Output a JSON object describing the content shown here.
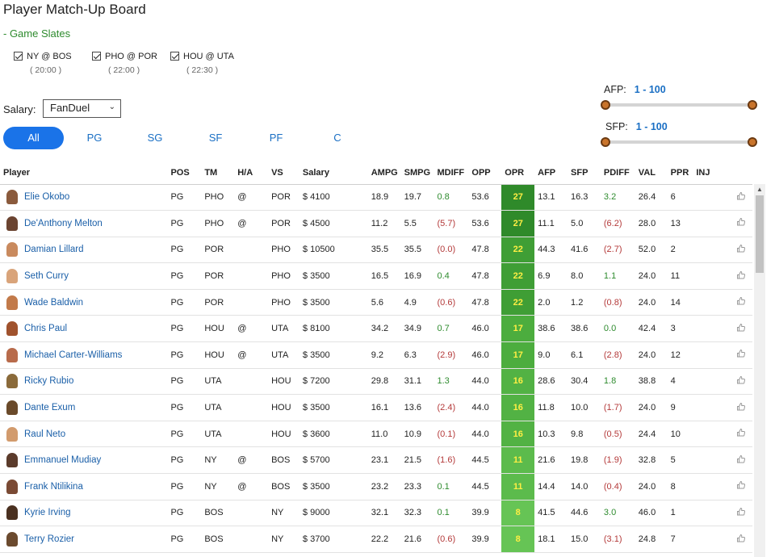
{
  "page": {
    "title": "Player Match-Up Board",
    "slates_toggle": "- Game Slates"
  },
  "slates": [
    {
      "label": "NY @ BOS",
      "time": "( 20:00 )",
      "checked": true
    },
    {
      "label": "PHO @ POR",
      "time": "( 22:00 )",
      "checked": true
    },
    {
      "label": "HOU @ UTA",
      "time": "( 22:30 )",
      "checked": true
    }
  ],
  "salary": {
    "label": "Salary:",
    "selected": "FanDuel"
  },
  "sliders": {
    "afp": {
      "label": "AFP:",
      "range": "1 - 100",
      "min": 1,
      "max": 100
    },
    "sfp": {
      "label": "SFP:",
      "range": "1 - 100",
      "min": 1,
      "max": 100
    }
  },
  "position_tabs": [
    {
      "label": "All",
      "active": true
    },
    {
      "label": "PG",
      "active": false
    },
    {
      "label": "SG",
      "active": false
    },
    {
      "label": "SF",
      "active": false
    },
    {
      "label": "PF",
      "active": false
    },
    {
      "label": "C",
      "active": false
    }
  ],
  "table": {
    "columns": [
      "Player",
      "POS",
      "TM",
      "H/A",
      "VS",
      "Salary",
      "AMPG",
      "SMPG",
      "MDIFF",
      "OPP",
      "OPR",
      "AFP",
      "SFP",
      "PDIFF",
      "VAL",
      "PPR",
      "INJ"
    ],
    "rows": [
      {
        "player": "Elie Okobo",
        "pos": "PG",
        "tm": "PHO",
        "ha": "@",
        "vs": "POR",
        "salary": "$ 4100",
        "ampg": "18.9",
        "smpg": "19.7",
        "mdiff": "0.8",
        "opp": "53.6",
        "opr": "27",
        "afp": "13.1",
        "sfp": "16.3",
        "pdiff": "3.2",
        "val": "26.4",
        "ppr": "6",
        "inj": ""
      },
      {
        "player": "De'Anthony Melton",
        "pos": "PG",
        "tm": "PHO",
        "ha": "@",
        "vs": "POR",
        "salary": "$ 4500",
        "ampg": "11.2",
        "smpg": "5.5",
        "mdiff": "(5.7)",
        "opp": "53.6",
        "opr": "27",
        "afp": "11.1",
        "sfp": "5.0",
        "pdiff": "(6.2)",
        "val": "28.0",
        "ppr": "13",
        "inj": ""
      },
      {
        "player": "Damian Lillard",
        "pos": "PG",
        "tm": "POR",
        "ha": "",
        "vs": "PHO",
        "salary": "$ 10500",
        "ampg": "35.5",
        "smpg": "35.5",
        "mdiff": "(0.0)",
        "opp": "47.8",
        "opr": "22",
        "afp": "44.3",
        "sfp": "41.6",
        "pdiff": "(2.7)",
        "val": "52.0",
        "ppr": "2",
        "inj": ""
      },
      {
        "player": "Seth Curry",
        "pos": "PG",
        "tm": "POR",
        "ha": "",
        "vs": "PHO",
        "salary": "$ 3500",
        "ampg": "16.5",
        "smpg": "16.9",
        "mdiff": "0.4",
        "opp": "47.8",
        "opr": "22",
        "afp": "6.9",
        "sfp": "8.0",
        "pdiff": "1.1",
        "val": "24.0",
        "ppr": "11",
        "inj": ""
      },
      {
        "player": "Wade Baldwin",
        "pos": "PG",
        "tm": "POR",
        "ha": "",
        "vs": "PHO",
        "salary": "$ 3500",
        "ampg": "5.6",
        "smpg": "4.9",
        "mdiff": "(0.6)",
        "opp": "47.8",
        "opr": "22",
        "afp": "2.0",
        "sfp": "1.2",
        "pdiff": "(0.8)",
        "val": "24.0",
        "ppr": "14",
        "inj": ""
      },
      {
        "player": "Chris Paul",
        "pos": "PG",
        "tm": "HOU",
        "ha": "@",
        "vs": "UTA",
        "salary": "$ 8100",
        "ampg": "34.2",
        "smpg": "34.9",
        "mdiff": "0.7",
        "opp": "46.0",
        "opr": "17",
        "afp": "38.6",
        "sfp": "38.6",
        "pdiff": "0.0",
        "val": "42.4",
        "ppr": "3",
        "inj": ""
      },
      {
        "player": "Michael Carter-Williams",
        "pos": "PG",
        "tm": "HOU",
        "ha": "@",
        "vs": "UTA",
        "salary": "$ 3500",
        "ampg": "9.2",
        "smpg": "6.3",
        "mdiff": "(2.9)",
        "opp": "46.0",
        "opr": "17",
        "afp": "9.0",
        "sfp": "6.1",
        "pdiff": "(2.8)",
        "val": "24.0",
        "ppr": "12",
        "inj": ""
      },
      {
        "player": "Ricky Rubio",
        "pos": "PG",
        "tm": "UTA",
        "ha": "",
        "vs": "HOU",
        "salary": "$ 7200",
        "ampg": "29.8",
        "smpg": "31.1",
        "mdiff": "1.3",
        "opp": "44.0",
        "opr": "16",
        "afp": "28.6",
        "sfp": "30.4",
        "pdiff": "1.8",
        "val": "38.8",
        "ppr": "4",
        "inj": ""
      },
      {
        "player": "Dante Exum",
        "pos": "PG",
        "tm": "UTA",
        "ha": "",
        "vs": "HOU",
        "salary": "$ 3500",
        "ampg": "16.1",
        "smpg": "13.6",
        "mdiff": "(2.4)",
        "opp": "44.0",
        "opr": "16",
        "afp": "11.8",
        "sfp": "10.0",
        "pdiff": "(1.7)",
        "val": "24.0",
        "ppr": "9",
        "inj": ""
      },
      {
        "player": "Raul Neto",
        "pos": "PG",
        "tm": "UTA",
        "ha": "",
        "vs": "HOU",
        "salary": "$ 3600",
        "ampg": "11.0",
        "smpg": "10.9",
        "mdiff": "(0.1)",
        "opp": "44.0",
        "opr": "16",
        "afp": "10.3",
        "sfp": "9.8",
        "pdiff": "(0.5)",
        "val": "24.4",
        "ppr": "10",
        "inj": ""
      },
      {
        "player": "Emmanuel Mudiay",
        "pos": "PG",
        "tm": "NY",
        "ha": "@",
        "vs": "BOS",
        "salary": "$ 5700",
        "ampg": "23.1",
        "smpg": "21.5",
        "mdiff": "(1.6)",
        "opp": "44.5",
        "opr": "11",
        "afp": "21.6",
        "sfp": "19.8",
        "pdiff": "(1.9)",
        "val": "32.8",
        "ppr": "5",
        "inj": ""
      },
      {
        "player": "Frank Ntilikina",
        "pos": "PG",
        "tm": "NY",
        "ha": "@",
        "vs": "BOS",
        "salary": "$ 3500",
        "ampg": "23.2",
        "smpg": "23.3",
        "mdiff": "0.1",
        "opp": "44.5",
        "opr": "11",
        "afp": "14.4",
        "sfp": "14.0",
        "pdiff": "(0.4)",
        "val": "24.0",
        "ppr": "8",
        "inj": ""
      },
      {
        "player": "Kyrie Irving",
        "pos": "PG",
        "tm": "BOS",
        "ha": "",
        "vs": "NY",
        "salary": "$ 9000",
        "ampg": "32.1",
        "smpg": "32.3",
        "mdiff": "0.1",
        "opp": "39.9",
        "opr": "8",
        "afp": "41.5",
        "sfp": "44.6",
        "pdiff": "3.0",
        "val": "46.0",
        "ppr": "1",
        "inj": ""
      },
      {
        "player": "Terry Rozier",
        "pos": "PG",
        "tm": "BOS",
        "ha": "",
        "vs": "NY",
        "salary": "$ 3700",
        "ampg": "22.2",
        "smpg": "21.6",
        "mdiff": "(0.6)",
        "opp": "39.9",
        "opr": "8",
        "afp": "18.1",
        "sfp": "15.0",
        "pdiff": "(3.1)",
        "val": "24.8",
        "ppr": "7",
        "inj": ""
      }
    ]
  },
  "colors": {
    "accent": "#1a73e8",
    "link": "#1a5fa8",
    "positive": "#2e8b2e",
    "negative": "#b43a3a",
    "opr_27": "#2f8a2a",
    "opr_22": "#3f9e35",
    "opr_17": "#4cad3e",
    "opr_16": "#52b244",
    "opr_11": "#5cbb4c",
    "opr_8": "#66c455"
  },
  "icons": {
    "like": "thumbs-up-icon",
    "avatar": "player-avatar"
  }
}
